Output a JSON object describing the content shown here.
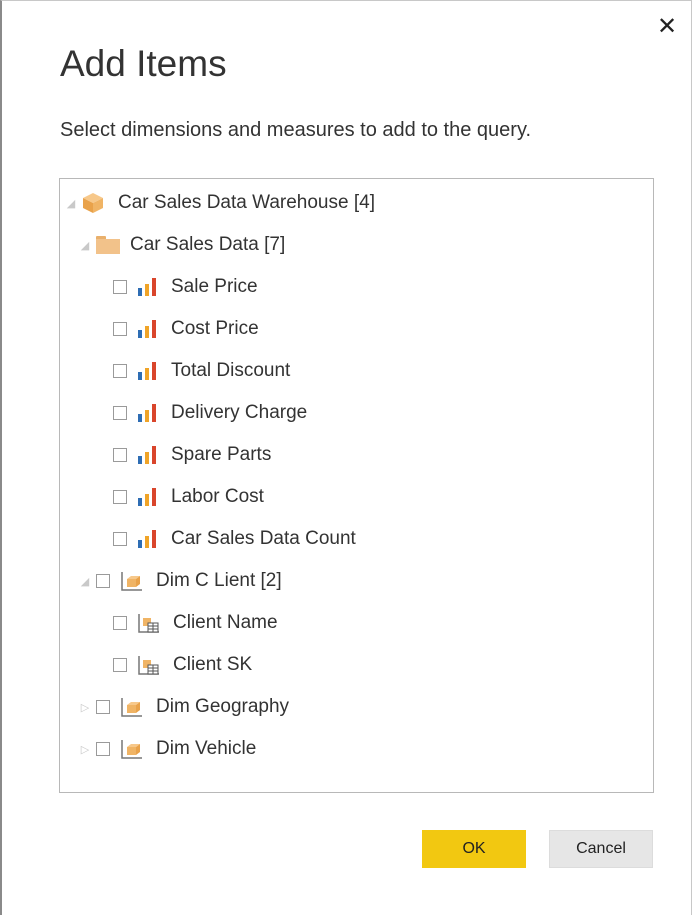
{
  "dialog": {
    "title": "Add Items",
    "subtitle": "Select dimensions and measures to add to the query.",
    "close_symbol": "✕"
  },
  "tree": {
    "root_label": "Car Sales Data Warehouse [4]",
    "folder_label": "Car Sales Data [7]",
    "measures": [
      "Sale Price",
      "Cost Price",
      "Total Discount",
      "Delivery Charge",
      "Spare Parts",
      "Labor Cost",
      "Car Sales Data Count"
    ],
    "dim_client": "Dim C Lient [2]",
    "client_attributes": [
      "Client Name",
      "Client SK"
    ],
    "dim_geography": "Dim Geography",
    "dim_vehicle": "Dim Vehicle"
  },
  "buttons": {
    "ok": "OK",
    "cancel": "Cancel"
  },
  "colors": {
    "ok_button": "#f2c811",
    "cancel_button": "#e6e6e6",
    "bar_blue": "#2e6db4",
    "bar_orange": "#f0a428",
    "bar_red": "#d9452b",
    "folder": "#f2c28a"
  },
  "icons": {
    "close": "close-icon",
    "root": "cube-icon",
    "folder": "folder-icon",
    "measure": "bar-chart-icon",
    "dimension": "dimension-icon",
    "attribute": "attribute-table-icon",
    "expanded": "expanded-triangle-icon",
    "collapsed": "collapsed-triangle-icon"
  }
}
